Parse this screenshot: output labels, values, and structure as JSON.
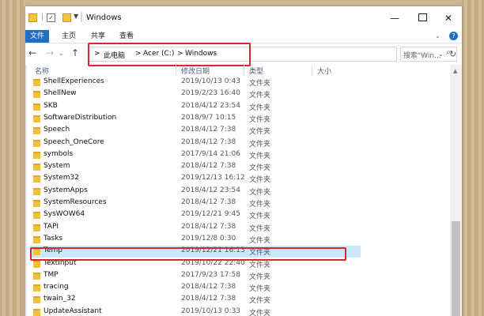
{
  "window": {
    "title": "Windows"
  },
  "ribbon": {
    "tabs": [
      "文件",
      "主页",
      "共享",
      "查看"
    ]
  },
  "address": {
    "crumbs": [
      "此电脑",
      "Acer (C:)",
      "Windows"
    ],
    "separator": ">"
  },
  "search": {
    "placeholder": "搜索\"Win..."
  },
  "columns": {
    "name": "名称",
    "date": "修改日期",
    "type": "类型",
    "size": "大小"
  },
  "files": [
    {
      "name": "ShellExperiences",
      "date": "2019/10/13 0:43",
      "type": "文件夹"
    },
    {
      "name": "ShellNew",
      "date": "2019/2/23 16:40",
      "type": "文件夹"
    },
    {
      "name": "SKB",
      "date": "2018/4/12 23:54",
      "type": "文件夹"
    },
    {
      "name": "SoftwareDistribution",
      "date": "2018/9/7 10:15",
      "type": "文件夹"
    },
    {
      "name": "Speech",
      "date": "2018/4/12 7:38",
      "type": "文件夹"
    },
    {
      "name": "Speech_OneCore",
      "date": "2018/4/12 7:38",
      "type": "文件夹"
    },
    {
      "name": "symbols",
      "date": "2017/9/14 21:06",
      "type": "文件夹"
    },
    {
      "name": "System",
      "date": "2018/4/12 7:38",
      "type": "文件夹"
    },
    {
      "name": "System32",
      "date": "2019/12/13 16:12",
      "type": "文件夹"
    },
    {
      "name": "SystemApps",
      "date": "2018/4/12 23:54",
      "type": "文件夹"
    },
    {
      "name": "SystemResources",
      "date": "2018/4/12 7:38",
      "type": "文件夹"
    },
    {
      "name": "SysWOW64",
      "date": "2019/12/21 9:45",
      "type": "文件夹"
    },
    {
      "name": "TAPI",
      "date": "2018/4/12 7:38",
      "type": "文件夹"
    },
    {
      "name": "Tasks",
      "date": "2019/12/8 0:30",
      "type": "文件夹"
    },
    {
      "name": "Temp",
      "date": "2019/12/21 16:13",
      "type": "文件夹",
      "selected": true
    },
    {
      "name": "TextInput",
      "date": "2019/10/22 22:40",
      "type": "文件夹"
    },
    {
      "name": "TMP",
      "date": "2017/9/23 17:58",
      "type": "文件夹"
    },
    {
      "name": "tracing",
      "date": "2018/4/12 7:38",
      "type": "文件夹"
    },
    {
      "name": "twain_32",
      "date": "2018/4/12 7:38",
      "type": "文件夹"
    },
    {
      "name": "UpdateAssistant",
      "date": "2019/10/13 0:33",
      "type": "文件夹"
    }
  ],
  "colors": {
    "accent": "#1e6fc4",
    "selection": "#cce8ff",
    "highlight": "#d9262e",
    "folder": "#f3c03c"
  }
}
